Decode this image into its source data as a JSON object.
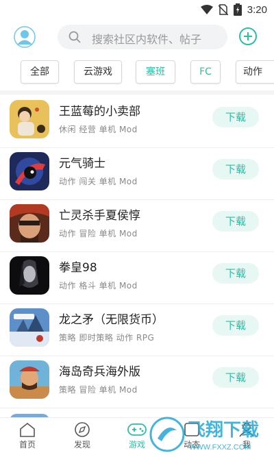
{
  "status_bar": {
    "time": "3:20"
  },
  "header": {
    "search_placeholder": "搜索社区内软件、帖子"
  },
  "chips": [
    "全部",
    "云游戏",
    "塞班",
    "FC",
    "动作"
  ],
  "apps": [
    {
      "name": "王蓝莓的小卖部",
      "tags": "休闲  经营  单机  Mod",
      "download": "下载"
    },
    {
      "name": "元气骑士",
      "tags": "动作  闯关  单机  Mod",
      "download": "下载"
    },
    {
      "name": "亡灵杀手夏侯惇",
      "tags": "动作  冒险  单机  Mod",
      "download": "下载"
    },
    {
      "name": "拳皇98",
      "tags": "动作  格斗  单机  Mod",
      "download": "下载"
    },
    {
      "name": "龙之矛（无限货币）",
      "tags": "策略  即时策略  动作  RPG",
      "download": "下载"
    },
    {
      "name": "海岛奇兵海外版",
      "tags": "策略  冒险  单机  Mod",
      "download": "下载"
    }
  ],
  "bottom_nav": [
    {
      "label": "首页"
    },
    {
      "label": "发现"
    },
    {
      "label": "游戏"
    },
    {
      "label": "动态"
    },
    {
      "label": "我"
    }
  ],
  "watermark": {
    "brand": "飞翔下载",
    "url": "WWW.FXXZ.COM"
  },
  "colors": {
    "accent": "#2bbfa2",
    "watermark": "#24a8d6"
  }
}
